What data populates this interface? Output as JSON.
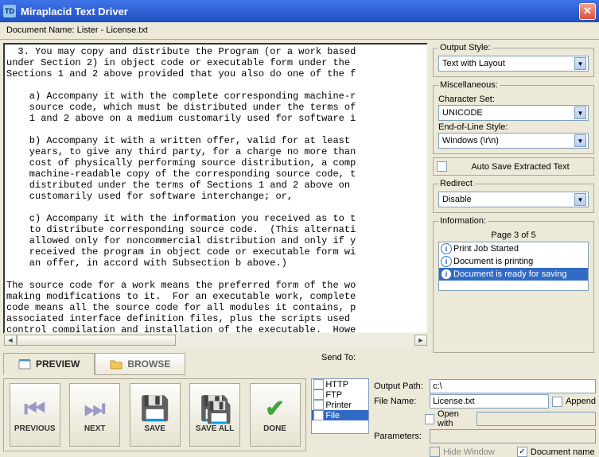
{
  "window": {
    "title": "Miraplacid Text Driver",
    "icon_text": "TD"
  },
  "document": {
    "label": "Document Name:",
    "value": "Lister - License.txt"
  },
  "preview_text": "  3. You may copy and distribute the Program (or a work based\nunder Section 2) in object code or executable form under the\nSections 1 and 2 above provided that you also do one of the f\n\n    a) Accompany it with the complete corresponding machine-r\n    source code, which must be distributed under the terms of\n    1 and 2 above on a medium customarily used for software i\n\n    b) Accompany it with a written offer, valid for at least \n    years, to give any third party, for a charge no more than\n    cost of physically performing source distribution, a comp\n    machine-readable copy of the corresponding source code, t\n    distributed under the terms of Sections 1 and 2 above on \n    customarily used for software interchange; or,\n\n    c) Accompany it with the information you received as to t\n    to distribute corresponding source code.  (This alternati\n    allowed only for noncommercial distribution and only if y\n    received the program in object code or executable form wi\n    an offer, in accord with Subsection b above.)\n\nThe source code for a work means the preferred form of the wo\nmaking modifications to it.  For an executable work, complete\ncode means all the source code for all modules it contains, p\nassociated interface definition files, plus the scripts used \ncontrol compilation and installation of the executable.  Howe\nspecial exception, the source code distributed need not inclu",
  "output_style": {
    "legend": "Output Style:",
    "value": "Text with Layout"
  },
  "misc": {
    "legend": "Miscellaneous:",
    "charset_label": "Character Set:",
    "charset_value": "UNICODE",
    "eol_label": "End-of-Line Style:",
    "eol_value": "Windows (\\r\\n)"
  },
  "autosave": "Auto Save Extracted Text",
  "redirect": {
    "legend": "Redirect",
    "value": "Disable"
  },
  "information": {
    "legend": "Information:",
    "page": "Page 3 of 5",
    "items": [
      "Print Job Started",
      "Document is printing",
      "Document is ready for saving"
    ]
  },
  "tabs": {
    "preview": "PREVIEW",
    "browse": "BROWSE"
  },
  "actions": {
    "previous": "PREVIOUS",
    "next": "NEXT",
    "save": "SAVE",
    "saveall": "SAVE ALL",
    "done": "DONE"
  },
  "sendto": {
    "label": "Send To:",
    "items": [
      "HTTP",
      "FTP",
      "Printer",
      "File"
    ]
  },
  "output": {
    "path_label": "Output Path:",
    "path_value": "c:\\",
    "filename_label": "File Name:",
    "filename_value": "License.txt",
    "append": "Append",
    "openwith": "Open with",
    "params": "Parameters:",
    "hidewin": "Hide Window",
    "docname": "Document name"
  }
}
